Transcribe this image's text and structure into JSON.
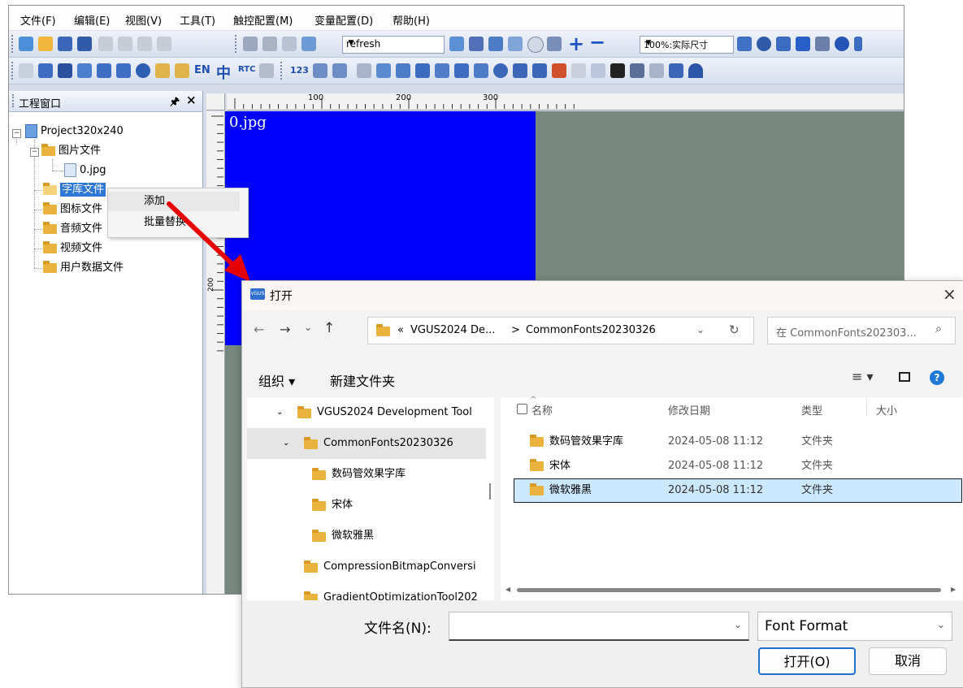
{
  "ide": {
    "menu": [
      "文件(F)",
      "编辑(E)",
      "视图(V)",
      "工具(T)",
      "触控配置(M)",
      "变量配置(D)",
      "帮助(H)"
    ],
    "toolbar1": {
      "combo_refresh": "refresh",
      "combo_zoom": "100%:实际尺寸"
    },
    "toolbar2": {
      "text_en": "EN",
      "text_zh": "中",
      "text_rtc": "RTC",
      "text_123": "123"
    },
    "project_pane": {
      "title": "工程窗口",
      "pin": "ᵩ",
      "close": "×",
      "tree": {
        "root": "Project320x240",
        "nodes": [
          "图片文件",
          "0.jpg",
          "字库文件",
          "图标文件",
          "音频文件",
          "视频文件",
          "用户数据文件"
        ]
      }
    },
    "ruler": {
      "top_ticks": [
        "100",
        "200",
        "300"
      ],
      "left_tick": "200"
    },
    "canvas": {
      "image_label": "0.jpg"
    },
    "context_menu": [
      "添加",
      "批量替换"
    ]
  },
  "dialog": {
    "title": "打开",
    "app_badge": "VGUS",
    "close": "×",
    "path": [
      "«",
      "VGUS2024 De...",
      ">",
      "CommonFonts20230326"
    ],
    "search_placeholder": "在 CommonFonts202303...",
    "toolbar": {
      "organize": "组织 ▾",
      "new_folder": "新建文件夹"
    },
    "nav": [
      "VGUS2024 Development Tool",
      "CommonFonts20230326",
      "数码管效果字库",
      "宋体",
      "微软雅黑",
      "CompressionBitmapConversi",
      "GradientOptimizationTool202"
    ],
    "columns": [
      "名称",
      "修改日期",
      "类型",
      "大小"
    ],
    "files": [
      {
        "name": "数码管效果字库",
        "date": "2024-05-08 11:12",
        "type": "文件夹"
      },
      {
        "name": "宋体",
        "date": "2024-05-08 11:12",
        "type": "文件夹"
      },
      {
        "name": "微软雅黑",
        "date": "2024-05-08 11:12",
        "type": "文件夹"
      }
    ],
    "filename_label": "文件名(N):",
    "filename_value": "",
    "filter": "Font Format",
    "open_button": "打开(O)",
    "cancel_button": "取消"
  },
  "colors": {
    "canvas_blue": "#0000ff",
    "canvas_gray": "#77887f",
    "selection": "#cce8ff",
    "arrow": "#e60000"
  }
}
